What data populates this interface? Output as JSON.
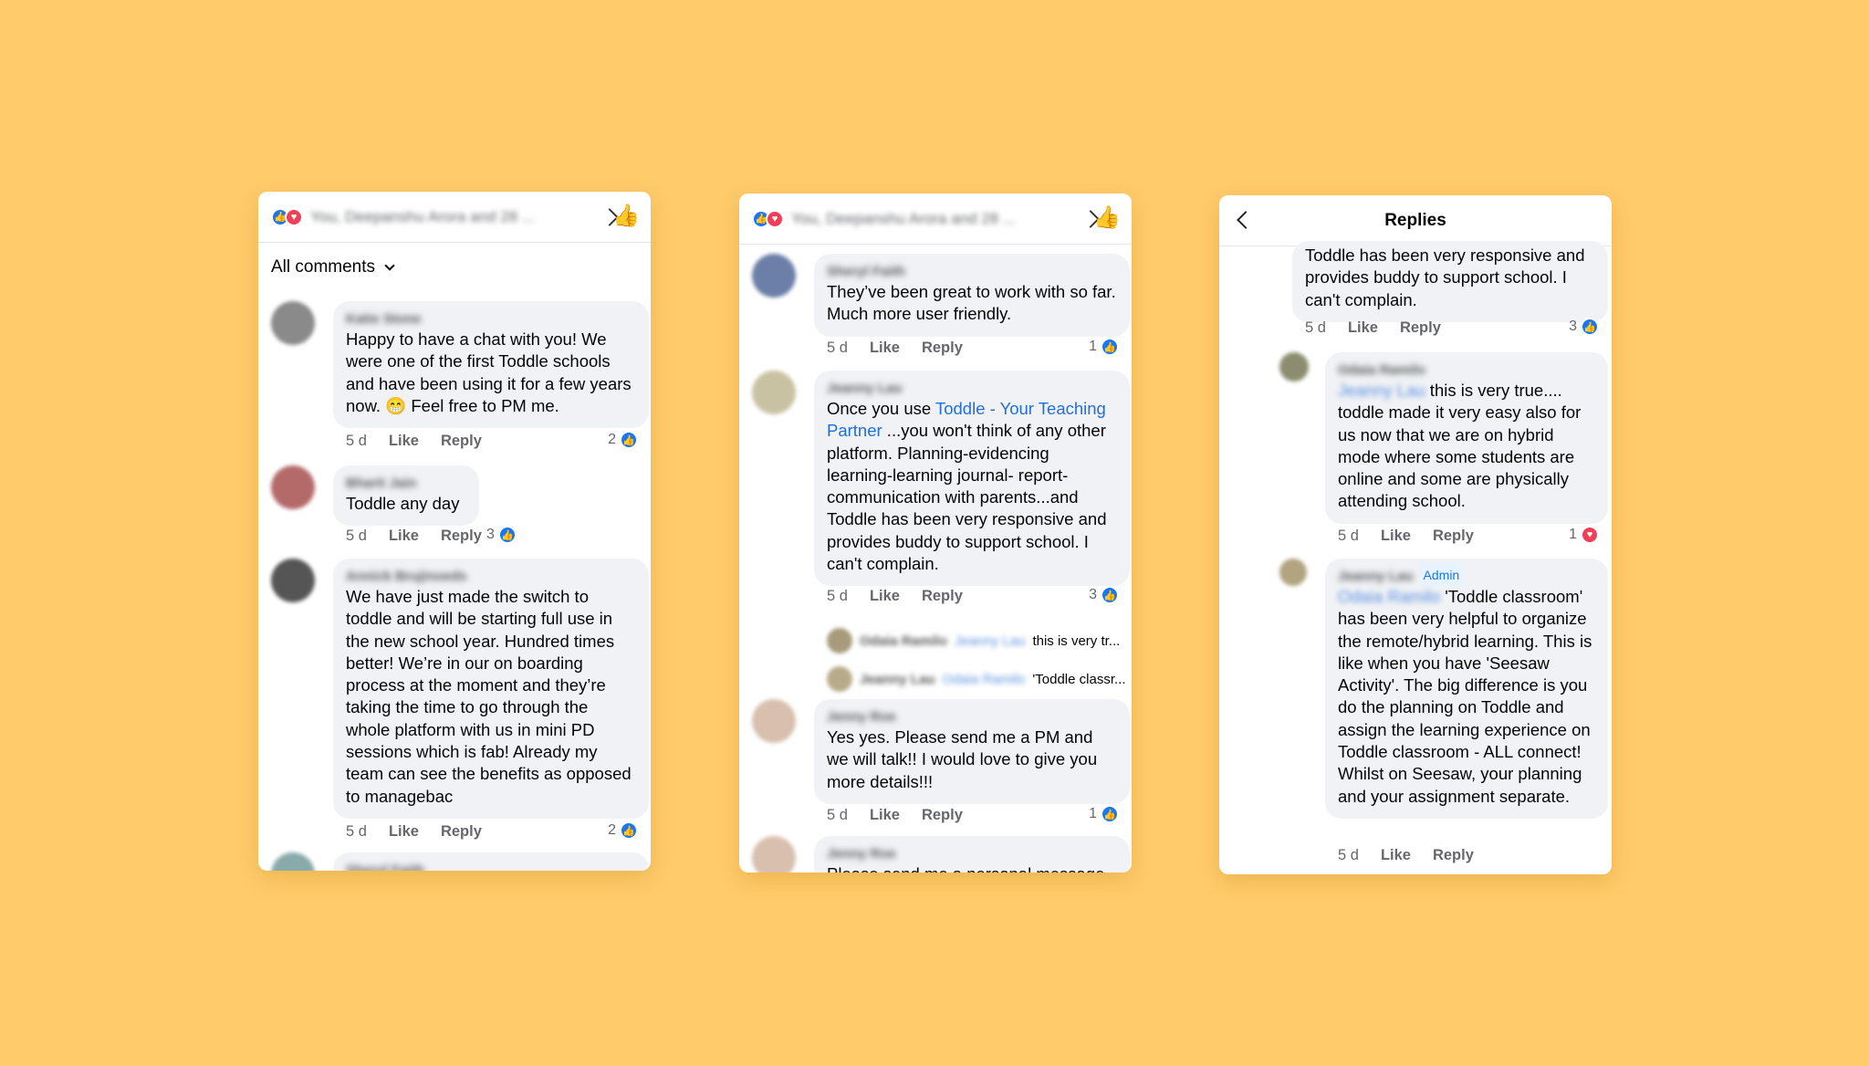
{
  "panel1": {
    "header_text": "You, Deepanshu Arora and 28 ...",
    "filter_label": "All comments",
    "comments": [
      {
        "name": "Katie Stone",
        "text": "Happy to have a chat with you! We were one of the first Toddle schools and have been using it for a few years now. 😁 Feel free to PM me.",
        "time": "5 d",
        "like": "Like",
        "reply": "Reply",
        "count": "2"
      },
      {
        "name": "Bharti Jain",
        "text": "Toddle any day",
        "time": "5 d",
        "like": "Like",
        "reply": "Reply",
        "count": "3"
      },
      {
        "name": "Annick Brujinoeds",
        "text": "We have just made the switch to toddle and will be starting full use in the new school year. Hundred times better! We’re in our on boarding process at the moment and they’re taking the time to go through the whole platform with us in mini PD sessions which is fab! Already my team can see the benefits as opposed to managebac",
        "time": "5 d",
        "like": "Like",
        "reply": "Reply",
        "count": "2"
      },
      {
        "name": "Sheryl Faith"
      }
    ]
  },
  "panel2": {
    "header_text": "You, Deepanshu Arora and 28 ...",
    "comments": [
      {
        "name": "Sheryl Faith",
        "text": "They’ve been great to work with so far. Much more user friendly.",
        "time": "5 d",
        "like": "Like",
        "reply": "Reply",
        "count": "1"
      },
      {
        "name": "Jeanny Lau",
        "text_before": "Once you use ",
        "link": "Toddle - Your Teaching Partner",
        "text_after": " ...you won't think of any other platform.  Planning-evidencing learning-learning journal- report-communication with parents...and Toddle has been very responsive and provides buddy to support school.  I can't complain.",
        "time": "5 d",
        "like": "Like",
        "reply": "Reply",
        "count": "3"
      },
      {
        "name": "Jenny Roe",
        "text": "Yes yes. Please send me a PM and we will talk!! I would love to give you more  details!!!",
        "time": "5 d",
        "like": "Like",
        "reply": "Reply",
        "count": "1"
      },
      {
        "name": "Jenny Roe",
        "text": "Please send me a personal message"
      }
    ],
    "sub_replies": [
      {
        "name": "Odaia Ramilo",
        "mention": "Jeanny Lau",
        "text": "this is very tr..."
      },
      {
        "name": "Jeanny Lau",
        "mention": "Odaia Ramilo",
        "text": "'Toddle classr..."
      }
    ]
  },
  "panel3": {
    "title": "Replies",
    "top_text": "Toddle has been very responsive and provides buddy to support school.  I can't complain.",
    "top_time": "5 d",
    "top_like": "Like",
    "top_reply": "Reply",
    "top_count": "3",
    "replies": [
      {
        "name": "Odaia Ramilo",
        "mention": "Jeanny Lau",
        "text": " this is very true.... toddle made it very easy also for us now that we are on hybrid mode where some students are online and some are physically attending school.",
        "time": "5 d",
        "like": "Like",
        "reply": "Reply",
        "count": "1"
      },
      {
        "name": "Jeanny Lau",
        "badge": "Admin",
        "mention": "Odaia Ramilo",
        "text": " 'Toddle classroom' has been very helpful to organize the remote/hybrid learning.  This is like when you have 'Seesaw Activity'.  The big difference is you do the planning on Toddle and assign the learning experience on Toddle classroom - ALL connect!  Whilst on Seesaw, your planning and your assignment separate.",
        "time": "5 d",
        "like": "Like",
        "reply": "Reply"
      }
    ]
  },
  "colors": {
    "background": "#FFCB6B",
    "like_blue": "#1877f2",
    "love_red": "#f33e58",
    "link": "#216fdb"
  }
}
